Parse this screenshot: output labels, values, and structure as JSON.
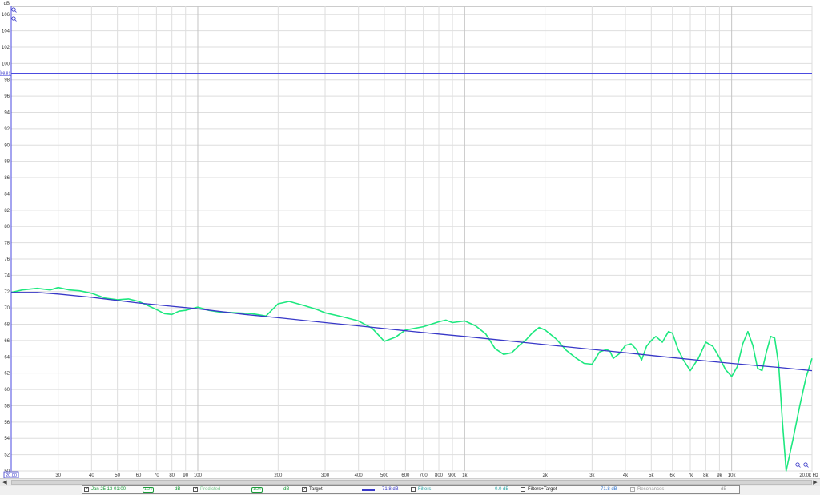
{
  "toolbar_icons": [
    "zoom-in-icon",
    "zoom-out-icon",
    "resize-icon"
  ],
  "chart_data": {
    "type": "line",
    "y_unit_label": "dB",
    "x_unit_label": "Hz",
    "x_scale": "log",
    "xlim": [
      20,
      20000
    ],
    "ylim": [
      50,
      107
    ],
    "grid": true,
    "y_ticks": [
      50,
      52,
      54,
      56,
      58,
      60,
      62,
      64,
      66,
      68,
      70,
      72,
      74,
      76,
      78,
      80,
      82,
      84,
      86,
      88,
      90,
      92,
      94,
      96,
      98,
      100,
      102,
      104,
      106
    ],
    "x_ticks": [
      {
        "value": 30,
        "label": "30"
      },
      {
        "value": 40,
        "label": "40"
      },
      {
        "value": 50,
        "label": "50"
      },
      {
        "value": 60,
        "label": "60"
      },
      {
        "value": 70,
        "label": "70"
      },
      {
        "value": 80,
        "label": "80"
      },
      {
        "value": 90,
        "label": "90"
      },
      {
        "value": 100,
        "label": "100"
      },
      {
        "value": 200,
        "label": "200"
      },
      {
        "value": 300,
        "label": "300"
      },
      {
        "value": 400,
        "label": "400"
      },
      {
        "value": 500,
        "label": "500"
      },
      {
        "value": 600,
        "label": "600"
      },
      {
        "value": 700,
        "label": "700"
      },
      {
        "value": 800,
        "label": "800"
      },
      {
        "value": 900,
        "label": "900"
      },
      {
        "value": 1000,
        "label": "1k"
      },
      {
        "value": 2000,
        "label": "2k"
      },
      {
        "value": 3000,
        "label": "3k"
      },
      {
        "value": 4000,
        "label": "4k"
      },
      {
        "value": 5000,
        "label": "5k"
      },
      {
        "value": 6000,
        "label": "6k"
      },
      {
        "value": 7000,
        "label": "7k"
      },
      {
        "value": 8000,
        "label": "8k"
      },
      {
        "value": 9000,
        "label": "9k"
      },
      {
        "value": 10000,
        "label": "10k"
      }
    ],
    "x_start_label": "20.00",
    "x_end_label": "20.0k Hz",
    "level_label": "98.81",
    "level_value": 98.81,
    "series": [
      {
        "id": "measurement",
        "color": "#1de87f",
        "x": [
          20,
          22,
          25,
          28,
          30,
          33,
          36,
          40,
          45,
          50,
          55,
          60,
          65,
          70,
          75,
          80,
          85,
          90,
          100,
          110,
          120,
          140,
          160,
          180,
          200,
          220,
          250,
          280,
          300,
          350,
          400,
          450,
          500,
          550,
          600,
          700,
          800,
          850,
          900,
          1000,
          1100,
          1200,
          1300,
          1400,
          1500,
          1600,
          1700,
          1800,
          1900,
          2000,
          2200,
          2400,
          2600,
          2800,
          3000,
          3200,
          3400,
          3500,
          3600,
          3800,
          4000,
          4200,
          4400,
          4600,
          4800,
          5000,
          5200,
          5500,
          5800,
          6000,
          6300,
          6600,
          7000,
          7500,
          8000,
          8500,
          9000,
          9500,
          10000,
          10500,
          11000,
          11500,
          12000,
          12500,
          13000,
          13500,
          14000,
          14500,
          15000,
          15500,
          16000,
          17000,
          18000,
          19000,
          20000
        ],
        "y": [
          71.9,
          72.2,
          72.4,
          72.2,
          72.5,
          72.2,
          72.1,
          71.8,
          71.2,
          71.0,
          71.1,
          70.8,
          70.3,
          69.8,
          69.3,
          69.2,
          69.6,
          69.7,
          70.1,
          69.7,
          69.5,
          69.4,
          69.3,
          69.0,
          70.5,
          70.8,
          70.3,
          69.8,
          69.4,
          68.9,
          68.4,
          67.5,
          65.9,
          66.4,
          67.3,
          67.7,
          68.3,
          68.5,
          68.2,
          68.4,
          67.8,
          66.8,
          65.0,
          64.3,
          64.5,
          65.4,
          66.1,
          67.0,
          67.6,
          67.3,
          66.2,
          64.8,
          63.9,
          63.2,
          63.1,
          64.6,
          64.9,
          64.7,
          63.8,
          64.4,
          65.4,
          65.6,
          64.9,
          63.6,
          65.3,
          66.0,
          66.5,
          65.8,
          67.1,
          66.9,
          64.9,
          63.6,
          62.3,
          63.8,
          65.8,
          65.3,
          63.9,
          62.4,
          61.6,
          62.8,
          65.6,
          67.1,
          65.4,
          62.6,
          62.3,
          64.6,
          66.5,
          66.3,
          63.0,
          56.0,
          49.0,
          54.0,
          58.0,
          61.5,
          63.8
        ]
      },
      {
        "id": "target",
        "color": "#3838c8",
        "x": [
          20,
          25,
          30,
          40,
          60,
          80,
          100,
          150,
          200,
          300,
          400,
          600,
          800,
          1000,
          2000,
          4000,
          6000,
          8000,
          10000,
          15000,
          20000
        ],
        "y": [
          71.9,
          71.9,
          71.7,
          71.3,
          70.6,
          70.2,
          69.9,
          69.2,
          68.8,
          68.2,
          67.8,
          67.2,
          66.8,
          66.5,
          65.5,
          64.5,
          63.9,
          63.5,
          63.2,
          62.7,
          62.3
        ]
      }
    ]
  },
  "legend": {
    "items": [
      {
        "name": "measurement",
        "checked": true,
        "label": "Jan 25 13 01:00",
        "smoothing": "1/24",
        "value": "dB",
        "value_color": "#1a9c3a",
        "label_color": "#1a9c3a"
      },
      {
        "name": "predicted",
        "checked": true,
        "label": "Predicted",
        "smoothing": "1/24",
        "value": "dB",
        "value_color": "#1a9c3a",
        "label_color": "#7acb8e"
      },
      {
        "name": "target",
        "checked": true,
        "label": "Target",
        "value": "71.8 dB",
        "value_color": "#3838c8",
        "label_color": "#222222",
        "swatch_color": "#3838c8"
      },
      {
        "name": "filters",
        "checked": false,
        "label": "Filters",
        "value": "0.0 dB",
        "value_color": "#2aa6a6",
        "label_color": "#2aa6a6"
      },
      {
        "name": "filters-target",
        "checked": false,
        "label": "Filters+Target",
        "value": "71.8 dB",
        "value_color": "#3a7ad0",
        "label_color": "#222222"
      },
      {
        "name": "resonances",
        "checked": true,
        "label": "Resonances",
        "value": "dB",
        "value_color": "#9a9a9a",
        "label_color": "#9a9a9a"
      }
    ]
  }
}
